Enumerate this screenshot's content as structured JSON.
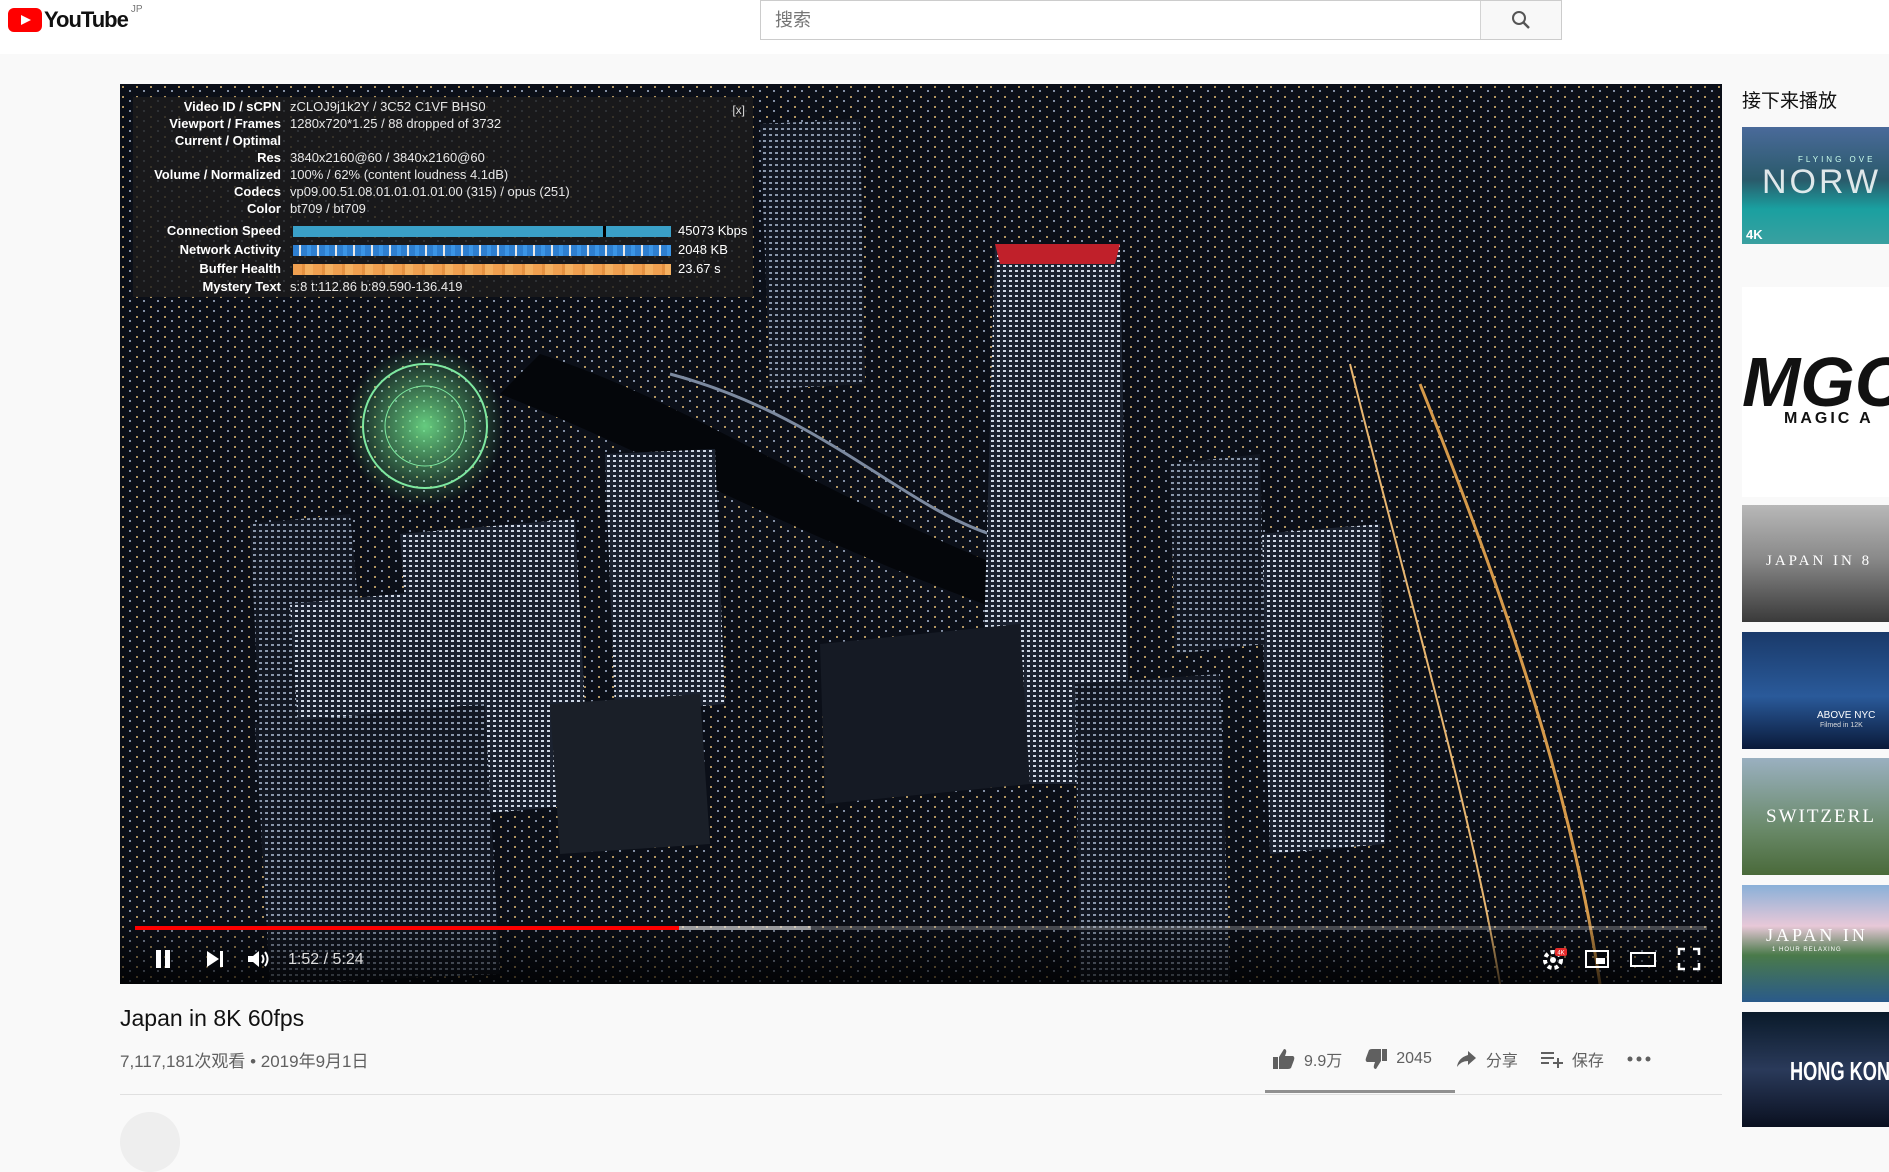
{
  "masthead": {
    "logo_text": "YouTube",
    "region": "JP",
    "search_placeholder": "搜索"
  },
  "player": {
    "stats": {
      "close": "[x]",
      "rows": [
        {
          "label": "Video ID / sCPN",
          "value": "zCLOJ9j1k2Y / 3C52 C1VF BHS0"
        },
        {
          "label": "Viewport / Frames",
          "value": "1280x720*1.25 / 88 dropped of 3732"
        },
        {
          "label": "Current / Optimal",
          "value": ""
        },
        {
          "label": "Res",
          "value": "3840x2160@60 / 3840x2160@60"
        },
        {
          "label": "Volume / Normalized",
          "value": "100% / 62% (content loudness 4.1dB)"
        },
        {
          "label": "Codecs",
          "value": "vp09.00.51.08.01.01.01.01.00 (315) / opus (251)"
        },
        {
          "label": "Color",
          "value": "bt709 / bt709"
        }
      ],
      "graphs": [
        {
          "label": "Connection Speed",
          "value": "45073 Kbps",
          "color": "#3aa0c8"
        },
        {
          "label": "Network Activity",
          "value": "2048 KB",
          "color": "#2e7fd0"
        },
        {
          "label": "Buffer Health",
          "value": "23.67 s",
          "color": "#f0a050"
        }
      ],
      "mystery": {
        "label": "Mystery Text",
        "value": "s:8 t:112.86 b:89.590-136.419"
      }
    },
    "time": "1:52 / 5:24",
    "played_fraction": 0.346,
    "buffered_fraction": 0.43,
    "quality_badge": "4K",
    "accent": "#ff0000"
  },
  "video": {
    "title": "Japan in 8K 60fps",
    "meta": "7,117,181次观看 • 2019年9月1日",
    "likes": "9.9万",
    "dislikes": "2045",
    "share": "分享",
    "save": "保存"
  },
  "sidebar": {
    "label": "接下来播放",
    "thumbnails": [
      {
        "text": "NORW",
        "sub": "FLYING OVE",
        "badge": "4K"
      },
      {
        "text": "MGC",
        "sub": "MAGIC A"
      },
      {
        "text": "JAPAN IN 8"
      },
      {
        "text": "ABOVE NYC",
        "sub": "Filmed in 12K"
      },
      {
        "text": "SWITZERL"
      },
      {
        "text": "JAPAN IN",
        "sub": "1 HOUR RELAXING"
      },
      {
        "text": "HONG KON"
      }
    ]
  }
}
